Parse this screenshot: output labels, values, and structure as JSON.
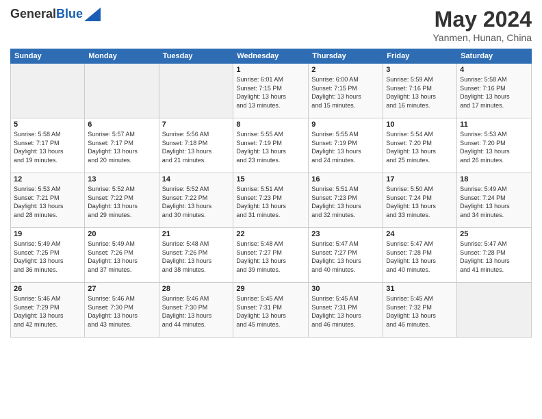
{
  "header": {
    "logo_general": "General",
    "logo_blue": "Blue",
    "month": "May 2024",
    "location": "Yanmen, Hunan, China"
  },
  "days_of_week": [
    "Sunday",
    "Monday",
    "Tuesday",
    "Wednesday",
    "Thursday",
    "Friday",
    "Saturday"
  ],
  "weeks": [
    [
      {
        "day": "",
        "info": ""
      },
      {
        "day": "",
        "info": ""
      },
      {
        "day": "",
        "info": ""
      },
      {
        "day": "1",
        "info": "Sunrise: 6:01 AM\nSunset: 7:15 PM\nDaylight: 13 hours\nand 13 minutes."
      },
      {
        "day": "2",
        "info": "Sunrise: 6:00 AM\nSunset: 7:15 PM\nDaylight: 13 hours\nand 15 minutes."
      },
      {
        "day": "3",
        "info": "Sunrise: 5:59 AM\nSunset: 7:16 PM\nDaylight: 13 hours\nand 16 minutes."
      },
      {
        "day": "4",
        "info": "Sunrise: 5:58 AM\nSunset: 7:16 PM\nDaylight: 13 hours\nand 17 minutes."
      }
    ],
    [
      {
        "day": "5",
        "info": "Sunrise: 5:58 AM\nSunset: 7:17 PM\nDaylight: 13 hours\nand 19 minutes."
      },
      {
        "day": "6",
        "info": "Sunrise: 5:57 AM\nSunset: 7:17 PM\nDaylight: 13 hours\nand 20 minutes."
      },
      {
        "day": "7",
        "info": "Sunrise: 5:56 AM\nSunset: 7:18 PM\nDaylight: 13 hours\nand 21 minutes."
      },
      {
        "day": "8",
        "info": "Sunrise: 5:55 AM\nSunset: 7:19 PM\nDaylight: 13 hours\nand 23 minutes."
      },
      {
        "day": "9",
        "info": "Sunrise: 5:55 AM\nSunset: 7:19 PM\nDaylight: 13 hours\nand 24 minutes."
      },
      {
        "day": "10",
        "info": "Sunrise: 5:54 AM\nSunset: 7:20 PM\nDaylight: 13 hours\nand 25 minutes."
      },
      {
        "day": "11",
        "info": "Sunrise: 5:53 AM\nSunset: 7:20 PM\nDaylight: 13 hours\nand 26 minutes."
      }
    ],
    [
      {
        "day": "12",
        "info": "Sunrise: 5:53 AM\nSunset: 7:21 PM\nDaylight: 13 hours\nand 28 minutes."
      },
      {
        "day": "13",
        "info": "Sunrise: 5:52 AM\nSunset: 7:22 PM\nDaylight: 13 hours\nand 29 minutes."
      },
      {
        "day": "14",
        "info": "Sunrise: 5:52 AM\nSunset: 7:22 PM\nDaylight: 13 hours\nand 30 minutes."
      },
      {
        "day": "15",
        "info": "Sunrise: 5:51 AM\nSunset: 7:23 PM\nDaylight: 13 hours\nand 31 minutes."
      },
      {
        "day": "16",
        "info": "Sunrise: 5:51 AM\nSunset: 7:23 PM\nDaylight: 13 hours\nand 32 minutes."
      },
      {
        "day": "17",
        "info": "Sunrise: 5:50 AM\nSunset: 7:24 PM\nDaylight: 13 hours\nand 33 minutes."
      },
      {
        "day": "18",
        "info": "Sunrise: 5:49 AM\nSunset: 7:24 PM\nDaylight: 13 hours\nand 34 minutes."
      }
    ],
    [
      {
        "day": "19",
        "info": "Sunrise: 5:49 AM\nSunset: 7:25 PM\nDaylight: 13 hours\nand 36 minutes."
      },
      {
        "day": "20",
        "info": "Sunrise: 5:49 AM\nSunset: 7:26 PM\nDaylight: 13 hours\nand 37 minutes."
      },
      {
        "day": "21",
        "info": "Sunrise: 5:48 AM\nSunset: 7:26 PM\nDaylight: 13 hours\nand 38 minutes."
      },
      {
        "day": "22",
        "info": "Sunrise: 5:48 AM\nSunset: 7:27 PM\nDaylight: 13 hours\nand 39 minutes."
      },
      {
        "day": "23",
        "info": "Sunrise: 5:47 AM\nSunset: 7:27 PM\nDaylight: 13 hours\nand 40 minutes."
      },
      {
        "day": "24",
        "info": "Sunrise: 5:47 AM\nSunset: 7:28 PM\nDaylight: 13 hours\nand 40 minutes."
      },
      {
        "day": "25",
        "info": "Sunrise: 5:47 AM\nSunset: 7:28 PM\nDaylight: 13 hours\nand 41 minutes."
      }
    ],
    [
      {
        "day": "26",
        "info": "Sunrise: 5:46 AM\nSunset: 7:29 PM\nDaylight: 13 hours\nand 42 minutes."
      },
      {
        "day": "27",
        "info": "Sunrise: 5:46 AM\nSunset: 7:30 PM\nDaylight: 13 hours\nand 43 minutes."
      },
      {
        "day": "28",
        "info": "Sunrise: 5:46 AM\nSunset: 7:30 PM\nDaylight: 13 hours\nand 44 minutes."
      },
      {
        "day": "29",
        "info": "Sunrise: 5:45 AM\nSunset: 7:31 PM\nDaylight: 13 hours\nand 45 minutes."
      },
      {
        "day": "30",
        "info": "Sunrise: 5:45 AM\nSunset: 7:31 PM\nDaylight: 13 hours\nand 46 minutes."
      },
      {
        "day": "31",
        "info": "Sunrise: 5:45 AM\nSunset: 7:32 PM\nDaylight: 13 hours\nand 46 minutes."
      },
      {
        "day": "",
        "info": ""
      }
    ]
  ]
}
